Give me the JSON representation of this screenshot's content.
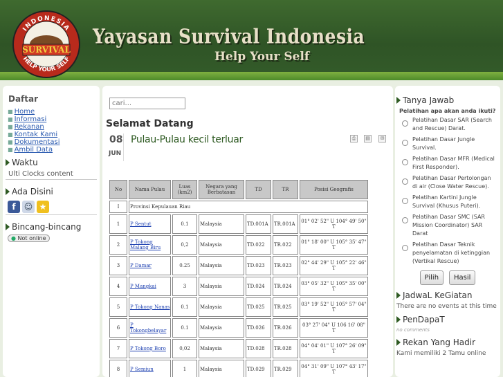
{
  "header": {
    "logo_text_top": "INDONESIA",
    "logo_text_mid": "SURVIVAL",
    "logo_text_bottom": "HELP YOUR SELF",
    "title": "Yayasan Survival Indonesia",
    "tagline": "Help Your Self",
    "colors": {
      "header_bg": "#2f5426",
      "title": "#e8e0c8",
      "accent": "#7fb040"
    }
  },
  "left": {
    "menu_title": "Daftar",
    "menu": [
      "Home",
      "Informasi",
      "Rekanan",
      "Kontak Kami",
      "Dokumentasi",
      "Ambil Data"
    ],
    "waktu_title": "Waktu",
    "waktu_content": "Ulti Clocks content",
    "ada_title": "Ada Disini",
    "social_icons": [
      "facebook-icon",
      "smiley-icon",
      "star-icon"
    ],
    "bincang_title": "Bincang-bincang",
    "online_status": "Not online"
  },
  "main": {
    "search_placeholder": "cari...",
    "welcome": "Selamat Datang",
    "date_day": "08",
    "date_month": "JUN",
    "article_title": "Pulau-Pulau kecil terluar",
    "tools": [
      "pdf-icon",
      "print-icon",
      "email-icon"
    ],
    "table": {
      "headers": [
        "No",
        "Nama Pulau",
        "Luas (km2)",
        "Negara yang Berbatasan",
        "TD",
        "TR",
        "Posisi Geografis"
      ],
      "province": {
        "no": "I",
        "name": "Provinsi Kepulauan Riau"
      },
      "rows": [
        {
          "no": "1",
          "name": "P Sentut",
          "luas": "0.1",
          "negara": "Malaysia",
          "td": "TD.001A",
          "tr": "TR.001A",
          "pos": "01° 02' 52\" U 104° 49' 50\" T"
        },
        {
          "no": "2",
          "name": "P Tokong Malang Biru",
          "luas": "0,2",
          "negara": "Malaysia",
          "td": "TD.022",
          "tr": "TR.022",
          "pos": "01° 18' 00\" U 105° 35' 47\" T"
        },
        {
          "no": "3",
          "name": "P Damar",
          "luas": "0.25",
          "negara": "Malaysia",
          "td": "TD.023",
          "tr": "TR.023",
          "pos": "02° 44' 29\" U 105° 22' 46\" T"
        },
        {
          "no": "4",
          "name": "P Mangkai",
          "luas": "3",
          "negara": "Malaysia",
          "td": "TD.024",
          "tr": "TR.024",
          "pos": "03° 05' 32\" U 105° 35' 00\" T"
        },
        {
          "no": "5",
          "name": "P Tokong Nanas",
          "luas": "0.1",
          "negara": "Malaysia",
          "td": "TD.025",
          "tr": "TR.025",
          "pos": "03° 19' 52\" U 105° 57' 04\" T"
        },
        {
          "no": "6",
          "name": "P Tokongbelayar",
          "luas": "0.1",
          "negara": "Malaysia",
          "td": "TD.026",
          "tr": "TR.026",
          "pos": "03° 27' 04\" U 106 16' 08\" T"
        },
        {
          "no": "7",
          "name": "P Tokong Boro",
          "luas": "0,02",
          "negara": "Malaysia",
          "td": "TD.028",
          "tr": "TR.028",
          "pos": "04° 04' 01\" U 107° 26' 09\" T"
        },
        {
          "no": "8",
          "name": "P Semiun",
          "luas": "1",
          "negara": "Malaysia",
          "td": "TD.029",
          "tr": "TR.029",
          "pos": "04° 31' 09\" U 107° 43' 17\" T"
        }
      ]
    }
  },
  "right": {
    "tanya_title": "Tanya Jawab",
    "poll_question": "Pelatihan apa akan anda ikuti?",
    "poll_options": [
      "Pelatihan Dasar SAR (Search and Rescue) Darat.",
      "Pelatihan Dasar Jungle Survival.",
      "Pelatihan Dasar MFR (Medical First Responder).",
      "Pelatihan Dasar Pertolongan di air (Close Water Rescue).",
      "Pelatihan Kartini Jungle Survival (Khusus Puteri).",
      "Pelatihan Dasar SMC (SAR Mission Coordinator) SAR Darat",
      "Pelatihan Dasar Teknik penyelamatan di ketinggian (Vertikal Rescue)"
    ],
    "vote_button": "Pilih",
    "result_button": "Hasil",
    "jadwal_title": "JadwaL KeGiatan",
    "jadwal_text": "There are no events at this time",
    "pendapat_title": "PenDapaT",
    "pendapat_text": "no comments",
    "rekan_title": "Rekan Yang Hadir",
    "rekan_text": "Kami memiliki 2 Tamu online"
  }
}
